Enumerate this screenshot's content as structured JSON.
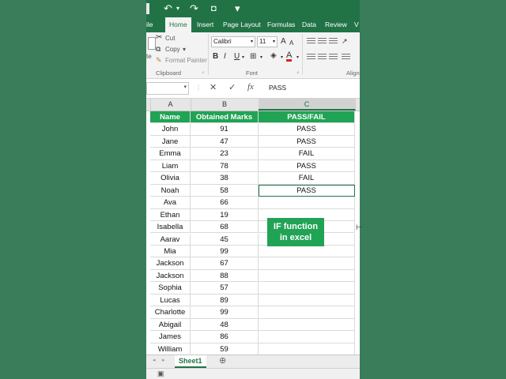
{
  "ribbon": {
    "tabs": [
      "ile",
      "Home",
      "Insert",
      "Page Layout",
      "Formulas",
      "Data",
      "Review",
      "V"
    ],
    "active_tab": "Home",
    "clipboard": {
      "cut": "Cut",
      "copy": "Copy",
      "copy_caret": "▾",
      "format_painter": "Format Painter",
      "paste_stub": "te",
      "group": "Clipboard"
    },
    "font": {
      "name": "Calibri",
      "size": "11",
      "group": "Font",
      "bold": "B",
      "italic": "I",
      "underline": "U",
      "grow": "A",
      "shrink": "A",
      "font_color": "A"
    },
    "alignment": {
      "group": "Align"
    }
  },
  "formula_bar": {
    "value": "PASS",
    "cancel": "✕",
    "enter": "✓",
    "fx": "fx"
  },
  "columns": [
    "A",
    "B",
    "C"
  ],
  "headers": [
    "Name",
    "Obtained Marks",
    "PASS/FAIL"
  ],
  "rows": [
    [
      "John",
      "91",
      "PASS"
    ],
    [
      "Jane",
      "47",
      "PASS"
    ],
    [
      "Emma",
      "23",
      "FAIL"
    ],
    [
      "Liam",
      "78",
      "PASS"
    ],
    [
      "Olivia",
      "38",
      "FAIL"
    ],
    [
      "Noah",
      "58",
      "PASS"
    ],
    [
      "Ava",
      "66",
      ""
    ],
    [
      "Ethan",
      "19",
      ""
    ],
    [
      "Isabella",
      "68",
      ""
    ],
    [
      "Aarav",
      "45",
      ""
    ],
    [
      "Mia",
      "99",
      ""
    ],
    [
      "Jackson",
      "67",
      ""
    ],
    [
      "Jackson",
      "88",
      ""
    ],
    [
      "Sophia",
      "57",
      ""
    ],
    [
      "Lucas",
      "89",
      ""
    ],
    [
      "Charlotte",
      "99",
      ""
    ],
    [
      "Abigail",
      "48",
      ""
    ],
    [
      "James",
      "86",
      ""
    ],
    [
      "William",
      "59",
      ""
    ]
  ],
  "active_cell": {
    "row": 5,
    "col": 2
  },
  "callout": {
    "line1": "IF function",
    "line2": "in excel"
  },
  "sheet": {
    "name": "Sheet1",
    "add": "⊕"
  },
  "colors": {
    "excel_green": "#217346",
    "header_fill": "#21a355",
    "background": "#3a7d5b"
  }
}
